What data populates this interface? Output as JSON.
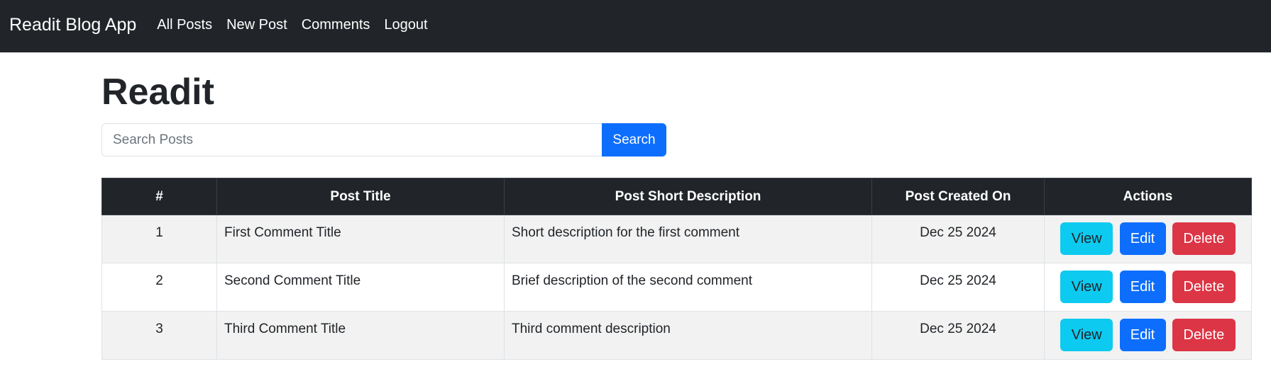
{
  "navbar": {
    "brand": "Readit Blog App",
    "links": [
      "All Posts",
      "New Post",
      "Comments",
      "Logout"
    ]
  },
  "page": {
    "title": "Readit"
  },
  "search": {
    "placeholder": "Search Posts",
    "value": "",
    "button_label": "Search"
  },
  "table": {
    "headers": [
      "#",
      "Post Title",
      "Post Short Description",
      "Post Created On",
      "Actions"
    ],
    "rows": [
      {
        "id": "1",
        "title": "First Comment Title",
        "description": "Short description for the first comment",
        "created_on": "Dec 25 2024"
      },
      {
        "id": "2",
        "title": "Second Comment Title",
        "description": "Brief description of the second comment",
        "created_on": "Dec 25 2024"
      },
      {
        "id": "3",
        "title": "Third Comment Title",
        "description": "Third comment description",
        "created_on": "Dec 25 2024"
      }
    ],
    "actions": {
      "view": "View",
      "edit": "Edit",
      "delete": "Delete"
    }
  },
  "colors": {
    "navbar_bg": "#212529",
    "primary": "#0d6efd",
    "info": "#0dcaf0",
    "danger": "#dc3545",
    "stripe": "#f2f2f2"
  }
}
